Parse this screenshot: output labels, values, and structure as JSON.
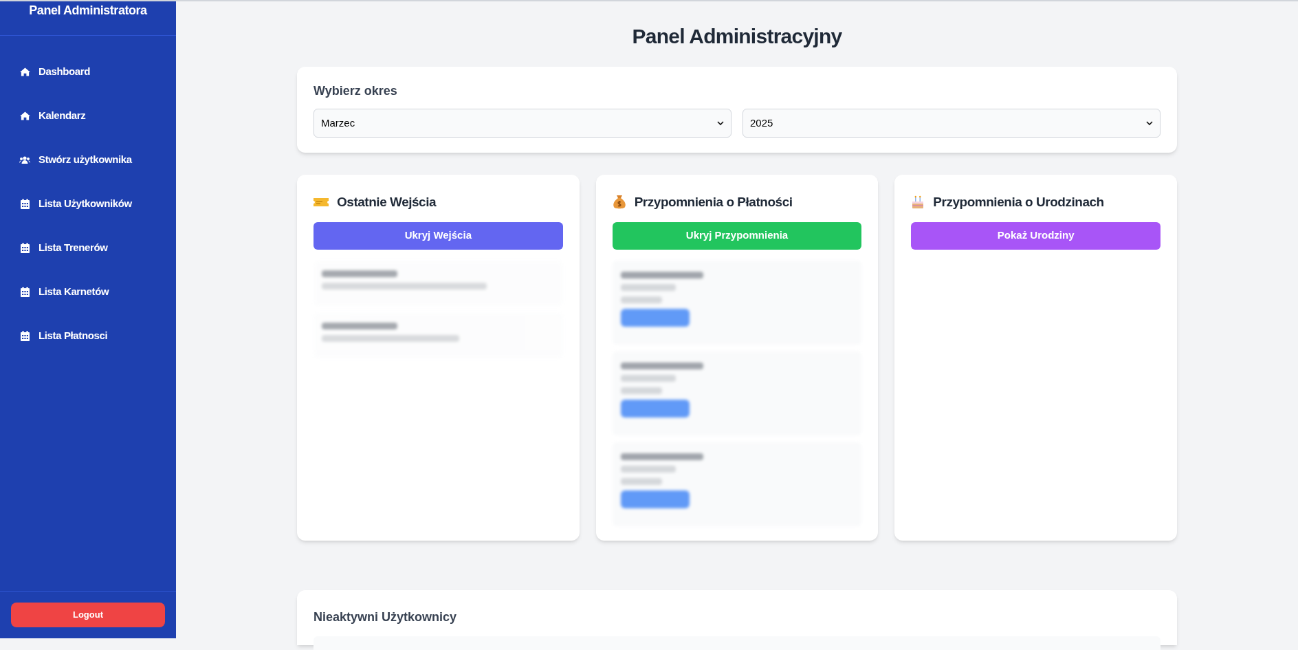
{
  "sidebar": {
    "title": "Panel Administratora",
    "items": [
      {
        "label": "Dashboard",
        "kind": "home"
      },
      {
        "label": "Kalendarz",
        "kind": "home"
      },
      {
        "label": "Stwórz użytkownika",
        "kind": "users"
      },
      {
        "label": "Lista Użytkowników",
        "kind": "calendar"
      },
      {
        "label": "Lista Trenerów",
        "kind": "calendar"
      },
      {
        "label": "Lista Karnetów",
        "kind": "calendar"
      },
      {
        "label": "Lista Płatnosci",
        "kind": "calendar"
      }
    ],
    "logout": "Logout"
  },
  "page_title": "Panel Administracyjny",
  "period": {
    "title": "Wybierz okres",
    "month": "Marzec",
    "year": "2025"
  },
  "cards": [
    {
      "title": "Ostatnie Wejścia",
      "button": "Ukryj Wejścia",
      "color": "#6366f1",
      "kind": "entries"
    },
    {
      "title": "Przypomnienia o Płatności",
      "button": "Ukryj Przypomnienia",
      "color": "#22c55e",
      "kind": "payments"
    },
    {
      "title": "Przypomnienia o Urodzinach",
      "button": "Pokaż Urodziny",
      "color": "#a855f7",
      "kind": "empty"
    }
  ],
  "inactive": {
    "title": "Nieaktywni Użytkownicy"
  }
}
